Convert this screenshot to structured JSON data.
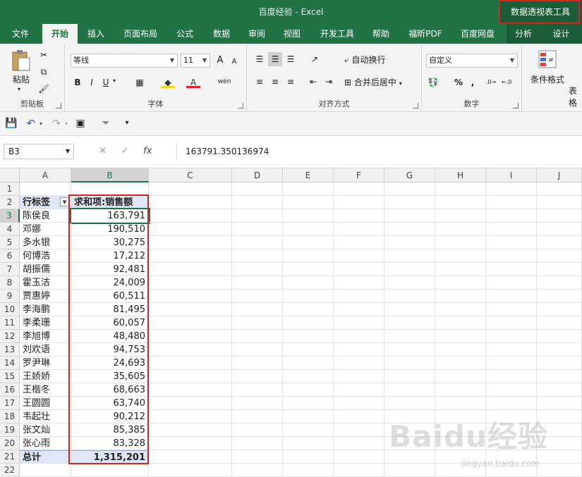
{
  "app": {
    "title": "百度经验  -  Excel",
    "context_tab_group": "数据透视表工具"
  },
  "tabs": [
    {
      "label": "文件"
    },
    {
      "label": "开始"
    },
    {
      "label": "插入"
    },
    {
      "label": "页面布局"
    },
    {
      "label": "公式"
    },
    {
      "label": "数据"
    },
    {
      "label": "审阅"
    },
    {
      "label": "视图"
    },
    {
      "label": "开发工具"
    },
    {
      "label": "帮助"
    },
    {
      "label": "福昕PDF"
    },
    {
      "label": "百度网盘"
    },
    {
      "label": "分析"
    },
    {
      "label": "设计"
    }
  ],
  "ribbon": {
    "clipboard": {
      "label": "剪贴板",
      "paste": "粘贴"
    },
    "font": {
      "label": "字体",
      "name": "等线",
      "size": "11",
      "bold": "B",
      "italic": "I",
      "underline": "U",
      "grow": "A",
      "shrink": "A",
      "color": "A",
      "phonetic": "wén"
    },
    "alignment": {
      "label": "对齐方式",
      "wrap": "自动换行",
      "merge": "合并后居中"
    },
    "number": {
      "label": "数字",
      "format": "自定义",
      "percent": "%",
      "comma": ","
    },
    "styles": {
      "conditional": "条件格式",
      "table": "表格"
    }
  },
  "formula_bar": {
    "name_box": "B3",
    "fx": "fx",
    "value": "163791.350136974"
  },
  "columns": [
    "A",
    "B",
    "C",
    "D",
    "E",
    "F",
    "G",
    "H",
    "I",
    "J"
  ],
  "pivot": {
    "row_label_header": "行标签",
    "value_header": "求和项:销售额",
    "rows": [
      {
        "name": "陈侯良",
        "value": "163,791"
      },
      {
        "name": "邓娜",
        "value": "190,510"
      },
      {
        "name": "多水银",
        "value": "30,275"
      },
      {
        "name": "何博浩",
        "value": "17,212"
      },
      {
        "name": "胡振儒",
        "value": "92,481"
      },
      {
        "name": "霍玉洁",
        "value": "24,009"
      },
      {
        "name": "贾惠婷",
        "value": "60,511"
      },
      {
        "name": "李海鹏",
        "value": "81,495"
      },
      {
        "name": "李柔珊",
        "value": "60,057"
      },
      {
        "name": "李旭博",
        "value": "48,480"
      },
      {
        "name": "刘欢语",
        "value": "94,753"
      },
      {
        "name": "罗尹琳",
        "value": "24,693"
      },
      {
        "name": "王娇娇",
        "value": "35,605"
      },
      {
        "name": "王楷冬",
        "value": "68,663"
      },
      {
        "name": "王圆圆",
        "value": "63,740"
      },
      {
        "name": "韦起壮",
        "value": "90,212"
      },
      {
        "name": "张文灿",
        "value": "85,385"
      },
      {
        "name": "张心雨",
        "value": "83,328"
      }
    ],
    "total_label": "总计",
    "total_value": "1,315,201"
  },
  "row_numbers": [
    "1",
    "2",
    "3",
    "4",
    "5",
    "6",
    "7",
    "8",
    "9",
    "10",
    "11",
    "12",
    "13",
    "14",
    "15",
    "16",
    "17",
    "18",
    "19",
    "20",
    "21",
    "22"
  ],
  "watermark": {
    "logo": "Baidu经验",
    "url": "jingyan.baidu.com"
  },
  "colors": {
    "excel_green": "#217346",
    "highlight_red": "#e02020",
    "pivot_header": "#dde6f4"
  }
}
